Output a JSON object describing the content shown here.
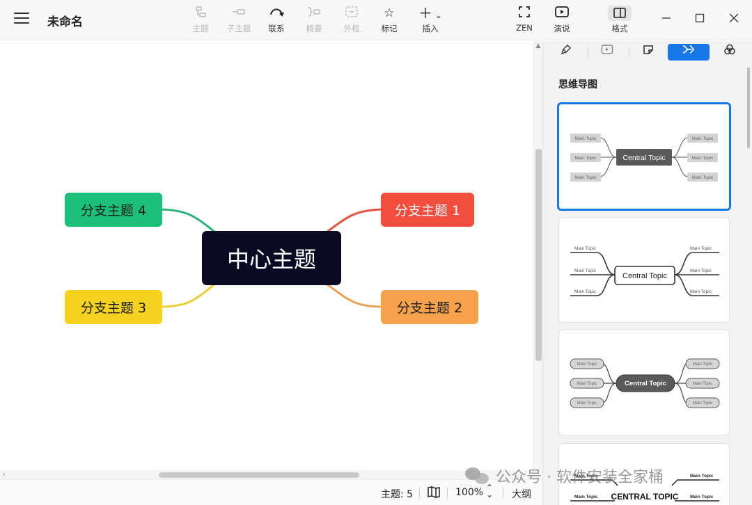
{
  "app": {
    "doc_title": "未命名"
  },
  "toolbar": {
    "topic": "主题",
    "subtopic": "子主题",
    "relation": "联系",
    "summary": "概要",
    "boundary": "外框",
    "marker": "标记",
    "insert": "插入",
    "zen": "ZEN",
    "present": "演说",
    "format": "格式"
  },
  "mindmap": {
    "central": "中心主题",
    "branches": [
      {
        "label": "分支主题 1",
        "color": "#f24e3f"
      },
      {
        "label": "分支主题 2",
        "color": "#f6a24a"
      },
      {
        "label": "分支主题 3",
        "color": "#f4d21f"
      },
      {
        "label": "分支主题 4",
        "color": "#1cbf78"
      }
    ],
    "central_color": "#0a0a23"
  },
  "status": {
    "topic_count": "主题: 5",
    "zoom": "100%",
    "outline": "大纲"
  },
  "panel": {
    "heading": "思维导图",
    "accent": "#1976e6",
    "themes": [
      {
        "central": "Central Topic",
        "main": "Main Topic"
      },
      {
        "central": "Central Topic",
        "main": "Main Topic"
      },
      {
        "central": "Central Topic",
        "main": "Main Topic"
      },
      {
        "central": "CENTRAL TOPIC",
        "main": "Main Topic"
      }
    ]
  },
  "watermark": "公众号 · 软件安装全家桶"
}
